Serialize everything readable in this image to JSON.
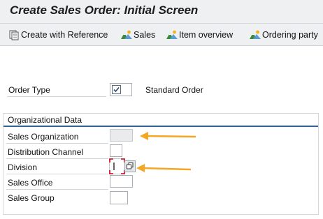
{
  "window": {
    "title": "Create Sales Order: Initial Screen"
  },
  "toolbar": {
    "create_with_reference": "Create with Reference",
    "sales": "Sales",
    "item_overview": "Item overview",
    "ordering_party": "Ordering party"
  },
  "form": {
    "order_type_label": "Order Type",
    "order_type_value": "",
    "order_type_description": "Standard Order",
    "org_group_title": "Organizational Data",
    "rows": [
      {
        "label": "Sales Organization",
        "value": ""
      },
      {
        "label": "Distribution Channel",
        "value": ""
      },
      {
        "label": "Division",
        "value": ""
      },
      {
        "label": "Sales Office",
        "value": ""
      },
      {
        "label": "Sales Group",
        "value": ""
      }
    ]
  },
  "colors": {
    "header_bg": "#eef0f2",
    "group_accent": "#34639a",
    "annotation_arrow": "#f5a623",
    "focus_frame": "#d0021b"
  },
  "icons": {
    "create_with_reference": "document-ref-icon",
    "sales": "mountain-icon",
    "item_overview": "mountain-icon",
    "ordering_party": "mountain-icon",
    "order_type_field": "checkmark-icon",
    "division_help": "value-help-icon"
  }
}
